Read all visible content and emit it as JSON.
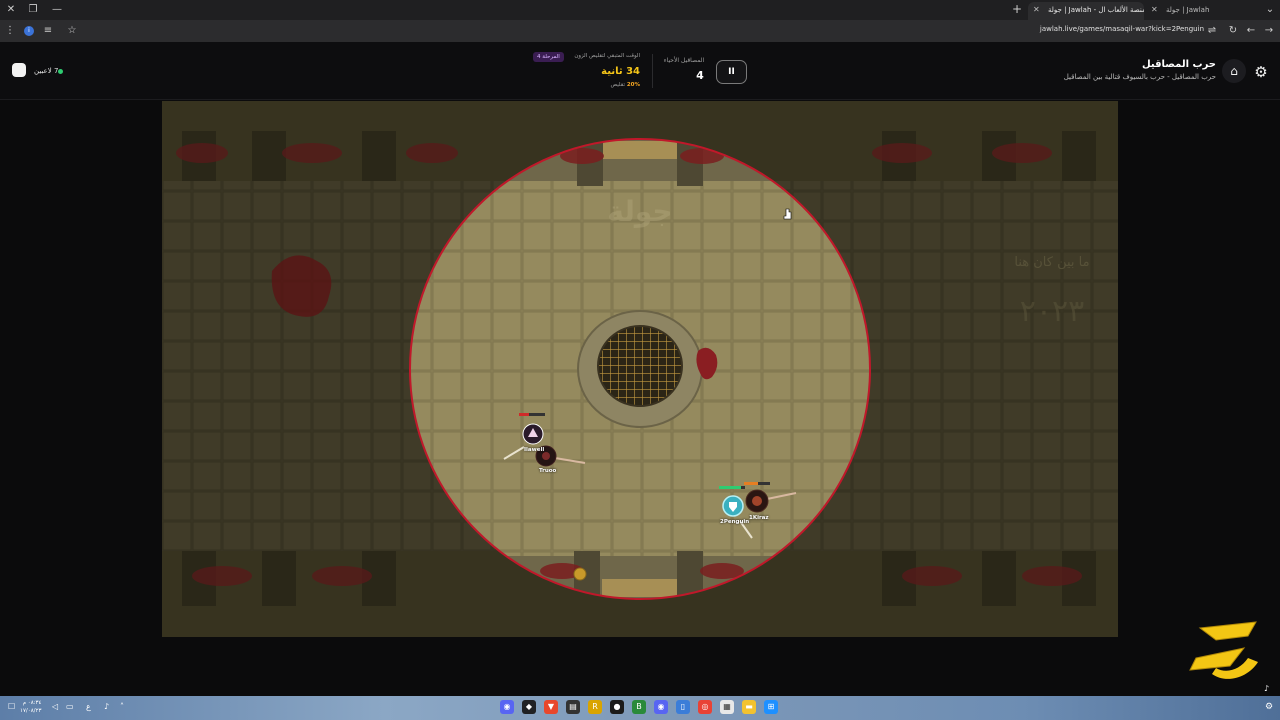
{
  "browser": {
    "tabs": [
      {
        "label": "جولة | Jawlah - منصة الألعاب ال"
      },
      {
        "label": "جولة | Jawlah - منصة الألعاب ال"
      },
      {
        "label": "جولة | Jawlah"
      }
    ],
    "url": "jawlah.live/games/masaqil-war?kick=2Penguin"
  },
  "game_header": {
    "title": "حرب المصاقيل",
    "subtitle": "حرب المصاقيل - حرب بالسيوف قتالية بين المصاقيل",
    "pause_label": "II",
    "alive_label": "المصاقيل الأحياء",
    "alive_count": "4",
    "time_label": "الوقت المتبقي لتقليص الزون",
    "stage_badge": "المرحلة 4",
    "time_value": "34 ثانية",
    "shrink_pct": "20%",
    "shrink_word": "تقليص",
    "players_online": "7 لاعبين"
  },
  "arena": {
    "players": [
      {
        "name": "Ilawell"
      },
      {
        "name": "Truoo"
      },
      {
        "name": "2Penguin"
      },
      {
        "name": "1Kiraz"
      }
    ],
    "floor_watermark": "جولة",
    "wall_text": "ما بين كان هنا"
  },
  "taskbar": {
    "time": "٠٨:٣٤ م",
    "date": "١٧/٠٨/٢٣",
    "lang": "ع"
  },
  "colors": {
    "accent_gold": "#f5c518",
    "zone_red": "#c0182a",
    "stage_purple": "#3a1d52",
    "online_green": "#2ecc71"
  }
}
